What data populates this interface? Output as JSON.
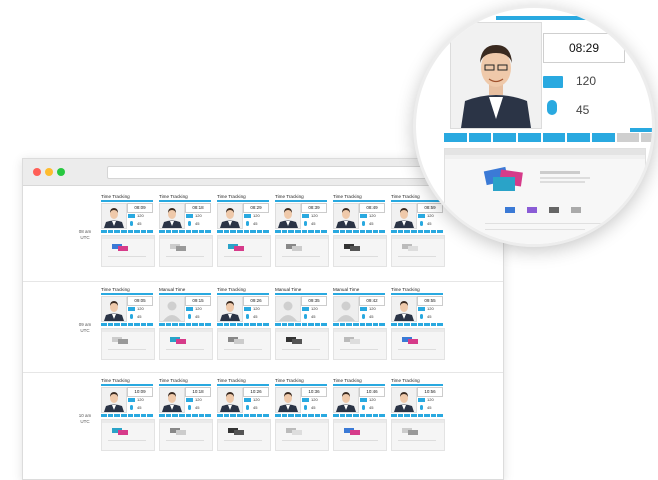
{
  "rows": [
    {
      "time_label": "08 am\nUTC",
      "cards": [
        {
          "title": "Time Tracking",
          "clock": "08:09",
          "keys": "120",
          "clicks": "45"
        },
        {
          "title": "Time Tracking",
          "clock": "08:18",
          "keys": "120",
          "clicks": "45"
        },
        {
          "title": "Time Tracking",
          "clock": "08:29",
          "keys": "120",
          "clicks": "45"
        },
        {
          "title": "Time Tracking",
          "clock": "08:39",
          "keys": "120",
          "clicks": "45"
        },
        {
          "title": "Time Tracking",
          "clock": "08:49",
          "keys": "120",
          "clicks": "45"
        },
        {
          "title": "Time Tracking",
          "clock": "08:59",
          "keys": "120",
          "clicks": "45"
        }
      ]
    },
    {
      "time_label": "09 am\nUTC",
      "cards": [
        {
          "title": "Time Tracking",
          "clock": "09:05",
          "keys": "120",
          "clicks": "45"
        },
        {
          "title": "Manual Time",
          "clock": "09:15",
          "keys": "120",
          "clicks": "45"
        },
        {
          "title": "Time Tracking",
          "clock": "09:26",
          "keys": "120",
          "clicks": "45"
        },
        {
          "title": "Manual Time",
          "clock": "09:35",
          "keys": "120",
          "clicks": "45"
        },
        {
          "title": "Manual Time",
          "clock": "09:42",
          "keys": "120",
          "clicks": "45"
        },
        {
          "title": "Time Tracking",
          "clock": "09:55",
          "keys": "120",
          "clicks": "45"
        }
      ]
    },
    {
      "time_label": "10 am\nUTC",
      "cards": [
        {
          "title": "Time Tracking",
          "clock": "10:09",
          "keys": "120",
          "clicks": "45"
        },
        {
          "title": "Time Tracking",
          "clock": "10:18",
          "keys": "120",
          "clicks": "45"
        },
        {
          "title": "Time Tracking",
          "clock": "10:26",
          "keys": "120",
          "clicks": "45"
        },
        {
          "title": "Time Tracking",
          "clock": "10:36",
          "keys": "120",
          "clicks": "45"
        },
        {
          "title": "Time Tracking",
          "clock": "10:46",
          "keys": "120",
          "clicks": "45"
        },
        {
          "title": "Time Tracking",
          "clock": "10:56",
          "keys": "120",
          "clicks": "45"
        }
      ]
    }
  ],
  "magnifier": {
    "clock": "08:29",
    "keys": "120",
    "clicks": "45"
  },
  "colors": {
    "accent": "#29a9e0",
    "close": "#ff5f57",
    "minimize": "#febc2e",
    "maximize": "#28c840"
  },
  "icons": {
    "keyboard": "keyboard-icon",
    "mouse": "mouse-icon"
  }
}
